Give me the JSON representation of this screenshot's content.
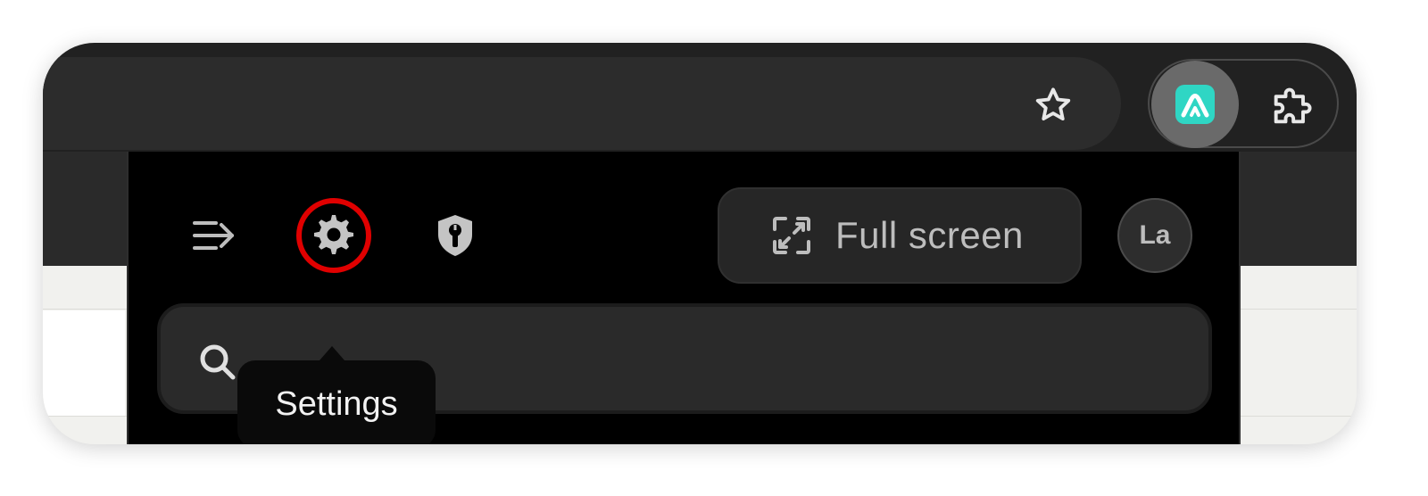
{
  "browser": {
    "bookmark_icon": "star-outline-icon",
    "extensions": [
      {
        "name": "vpn-extension-icon",
        "color": "#2fd6c4"
      },
      {
        "name": "puzzle-icon"
      }
    ]
  },
  "popup": {
    "toolbar": {
      "menu_icon": "collapse-menu-icon",
      "settings_icon": "gear-icon",
      "security_icon": "shield-wrench-icon",
      "fullscreen_label": "Full screen",
      "fullscreen_icon": "expand-icon",
      "avatar_initials": "La"
    },
    "search": {
      "placeholder": "",
      "icon": "search-icon"
    },
    "tooltip": {
      "text": "Settings"
    },
    "highlight_color": "#e00000"
  }
}
